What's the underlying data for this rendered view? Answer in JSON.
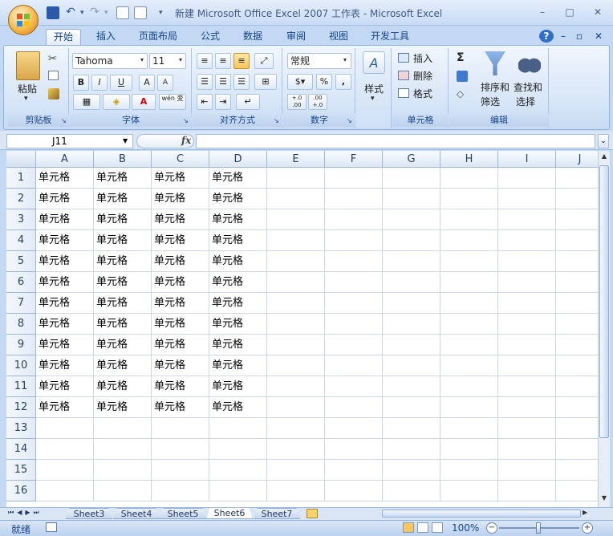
{
  "window": {
    "title": "新建 Microsoft Office Excel 2007 工作表 - Microsoft Excel",
    "controls": {
      "minimize": "–",
      "maximize": "□",
      "close": "✕"
    },
    "ribbon_controls": {
      "help": "?",
      "minimize": "–",
      "restore": "▫",
      "close": "✕"
    }
  },
  "tabs": [
    "开始",
    "插入",
    "页面布局",
    "公式",
    "数据",
    "审阅",
    "视图",
    "开发工具"
  ],
  "ribbon": {
    "clipboard": {
      "paste": "粘贴",
      "label": "剪贴板"
    },
    "font": {
      "name": "Tahoma",
      "size": "11",
      "bold": "B",
      "italic": "I",
      "underline": "U",
      "grow": "A",
      "shrink": "A",
      "font_color": "A",
      "phonetic": "wén 变",
      "label": "字体"
    },
    "alignment": {
      "label": "对齐方式"
    },
    "number": {
      "format": "常规",
      "percent": "%",
      "comma": ",",
      "inc_decimal": "+.0 .00",
      "dec_decimal": ".00 +.0",
      "label": "数字"
    },
    "styles": {
      "style": "样式"
    },
    "cells": {
      "insert": "插入",
      "delete": "删除",
      "format": "格式",
      "label": "单元格"
    },
    "editing": {
      "sigma": "Σ",
      "sort": "排序和",
      "sort2": "筛选",
      "find": "查找和",
      "find2": "选择",
      "label": "编辑"
    }
  },
  "formula_bar": {
    "name_box": "J11",
    "fx": "fx",
    "value": ""
  },
  "grid": {
    "columns": [
      "A",
      "B",
      "C",
      "D",
      "E",
      "F",
      "G",
      "H",
      "I",
      "J"
    ],
    "rows": [
      "1",
      "2",
      "3",
      "4",
      "5",
      "6",
      "7",
      "8",
      "9",
      "10",
      "11",
      "12",
      "13",
      "14",
      "15",
      "16"
    ],
    "cell_text": "单元格",
    "filled_rows": 12,
    "filled_cols": 4
  },
  "sheets": [
    "Sheet3",
    "Sheet4",
    "Sheet5",
    "Sheet6",
    "Sheet7"
  ],
  "active_sheet": "Sheet6",
  "status": {
    "ready": "就绪",
    "zoom": "100%"
  },
  "colors": {
    "ribbon_bg": "#dbe7f6",
    "active_tab": "#ffffff",
    "grid_line": "#d0d7e5",
    "header_bg": "#e4ecf7",
    "accent": "#15428b"
  }
}
